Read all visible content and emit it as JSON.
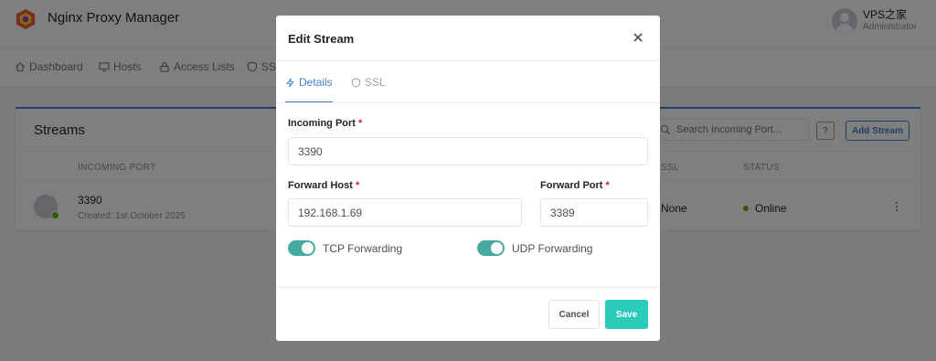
{
  "app": {
    "name": "Nginx Proxy Manager"
  },
  "user": {
    "name": "VPS之家",
    "role": "Administrator"
  },
  "nav": {
    "dashboard": "Dashboard",
    "hosts": "Hosts",
    "access_lists": "Access Lists",
    "ssl": "SSL"
  },
  "card": {
    "title": "Streams",
    "search_placeholder": "Search Incoming Port...",
    "help": "?",
    "add_button": "Add Stream",
    "columns": {
      "incoming_port": "INCOMING PORT",
      "ssl": "SSL",
      "status": "STATUS"
    },
    "row": {
      "port": "3390",
      "created": "Created: 1st October 2025",
      "ssl": "None",
      "status": "Online"
    }
  },
  "modal": {
    "title": "Edit Stream",
    "tabs": {
      "details": "Details",
      "ssl": "SSL"
    },
    "incoming_port": {
      "label": "Incoming Port",
      "value": "3390"
    },
    "forward_host": {
      "label": "Forward Host",
      "value": "192.168.1.69"
    },
    "forward_port": {
      "label": "Forward Port",
      "value": "3389"
    },
    "required_mark": "*",
    "tcp": {
      "label": "TCP Forwarding",
      "on": true
    },
    "udp": {
      "label": "UDP Forwarding",
      "on": true
    },
    "cancel": "Cancel",
    "save": "Save"
  },
  "colors": {
    "primary": "#467fcf",
    "save": "#2bcbba",
    "toggle": "#45aaa0",
    "online": "#5eba00",
    "required": "#cd201f"
  }
}
